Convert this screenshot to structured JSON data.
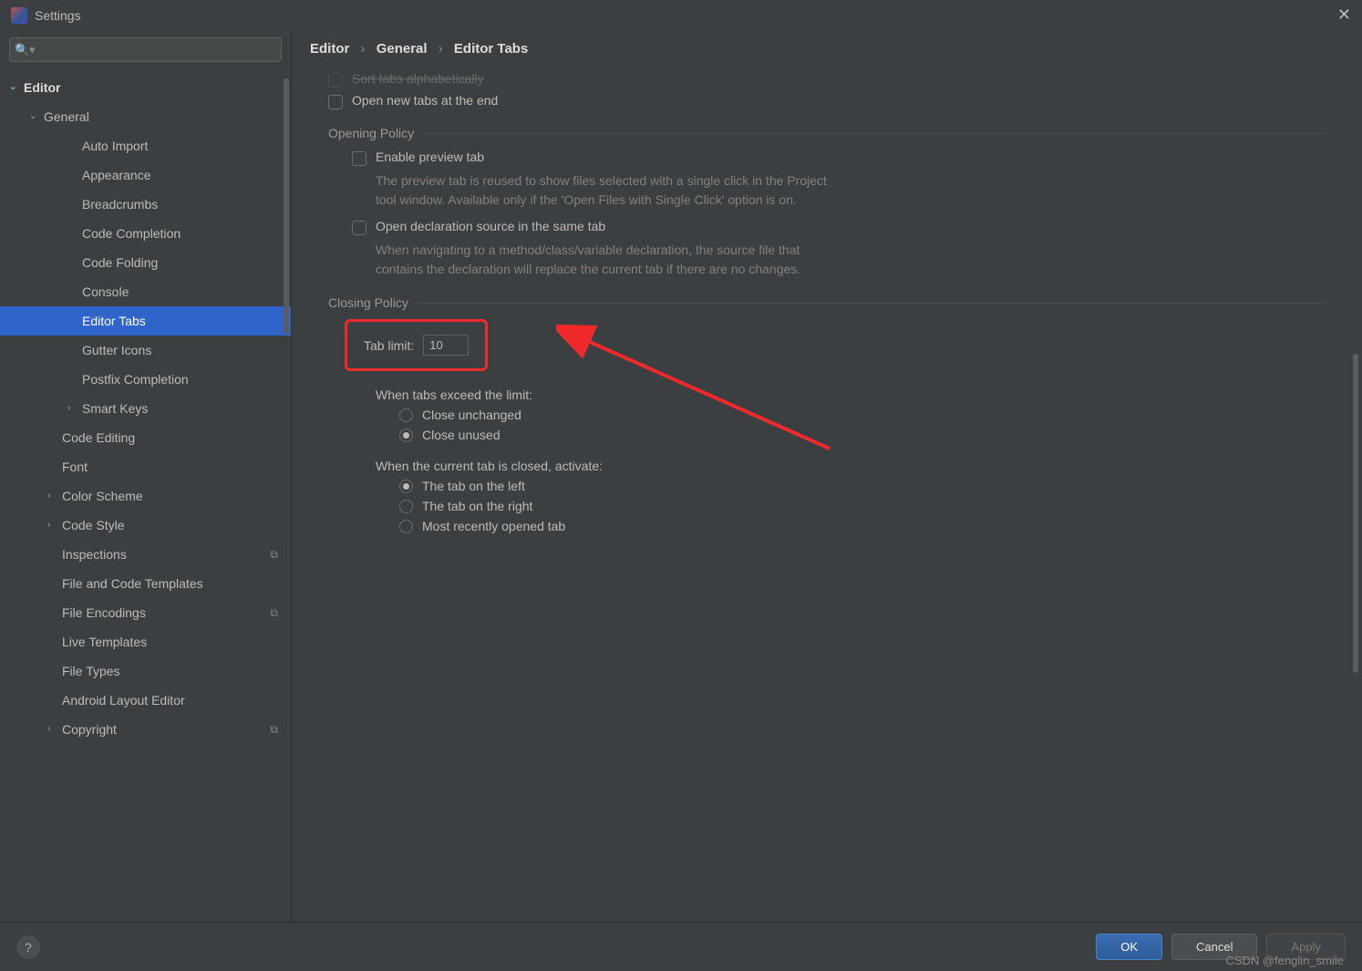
{
  "window": {
    "title": "Settings"
  },
  "sidebar": {
    "editor": "Editor",
    "general": "General",
    "items": {
      "auto_import": "Auto Import",
      "appearance": "Appearance",
      "breadcrumbs": "Breadcrumbs",
      "code_completion": "Code Completion",
      "code_folding": "Code Folding",
      "console": "Console",
      "editor_tabs": "Editor Tabs",
      "gutter_icons": "Gutter Icons",
      "postfix_completion": "Postfix Completion",
      "smart_keys": "Smart Keys"
    },
    "code_editing": "Code Editing",
    "font": "Font",
    "color_scheme": "Color Scheme",
    "code_style": "Code Style",
    "inspections": "Inspections",
    "file_templates": "File and Code Templates",
    "file_encodings": "File Encodings",
    "live_templates": "Live Templates",
    "file_types": "File Types",
    "android_layout": "Android Layout Editor",
    "copyright": "Copyright"
  },
  "crumbs": {
    "a": "Editor",
    "b": "General",
    "c": "Editor Tabs"
  },
  "top": {
    "sort_alpha": "Sort tabs alphabetically",
    "open_end": "Open new tabs at the end"
  },
  "opening": {
    "title": "Opening Policy",
    "preview": "Enable preview tab",
    "preview_desc": "The preview tab is reused to show files selected with a single click in the Project tool window. Available only if the 'Open Files with Single Click' option is on.",
    "decl": "Open declaration source in the same tab",
    "decl_desc": "When navigating to a method/class/variable declaration, the source file that contains the declaration will replace the current tab if there are no changes."
  },
  "closing": {
    "title": "Closing Policy",
    "tab_limit_label": "Tab limit:",
    "tab_limit_value": "10",
    "exceed_label": "When tabs exceed the limit:",
    "close_unchanged": "Close unchanged",
    "close_unused": "Close unused",
    "activate_label": "When the current tab is closed, activate:",
    "left": "The tab on the left",
    "right": "The tab on the right",
    "recent": "Most recently opened tab"
  },
  "footer": {
    "ok": "OK",
    "cancel": "Cancel",
    "apply": "Apply"
  },
  "watermark": "CSDN @fenglin_smile"
}
